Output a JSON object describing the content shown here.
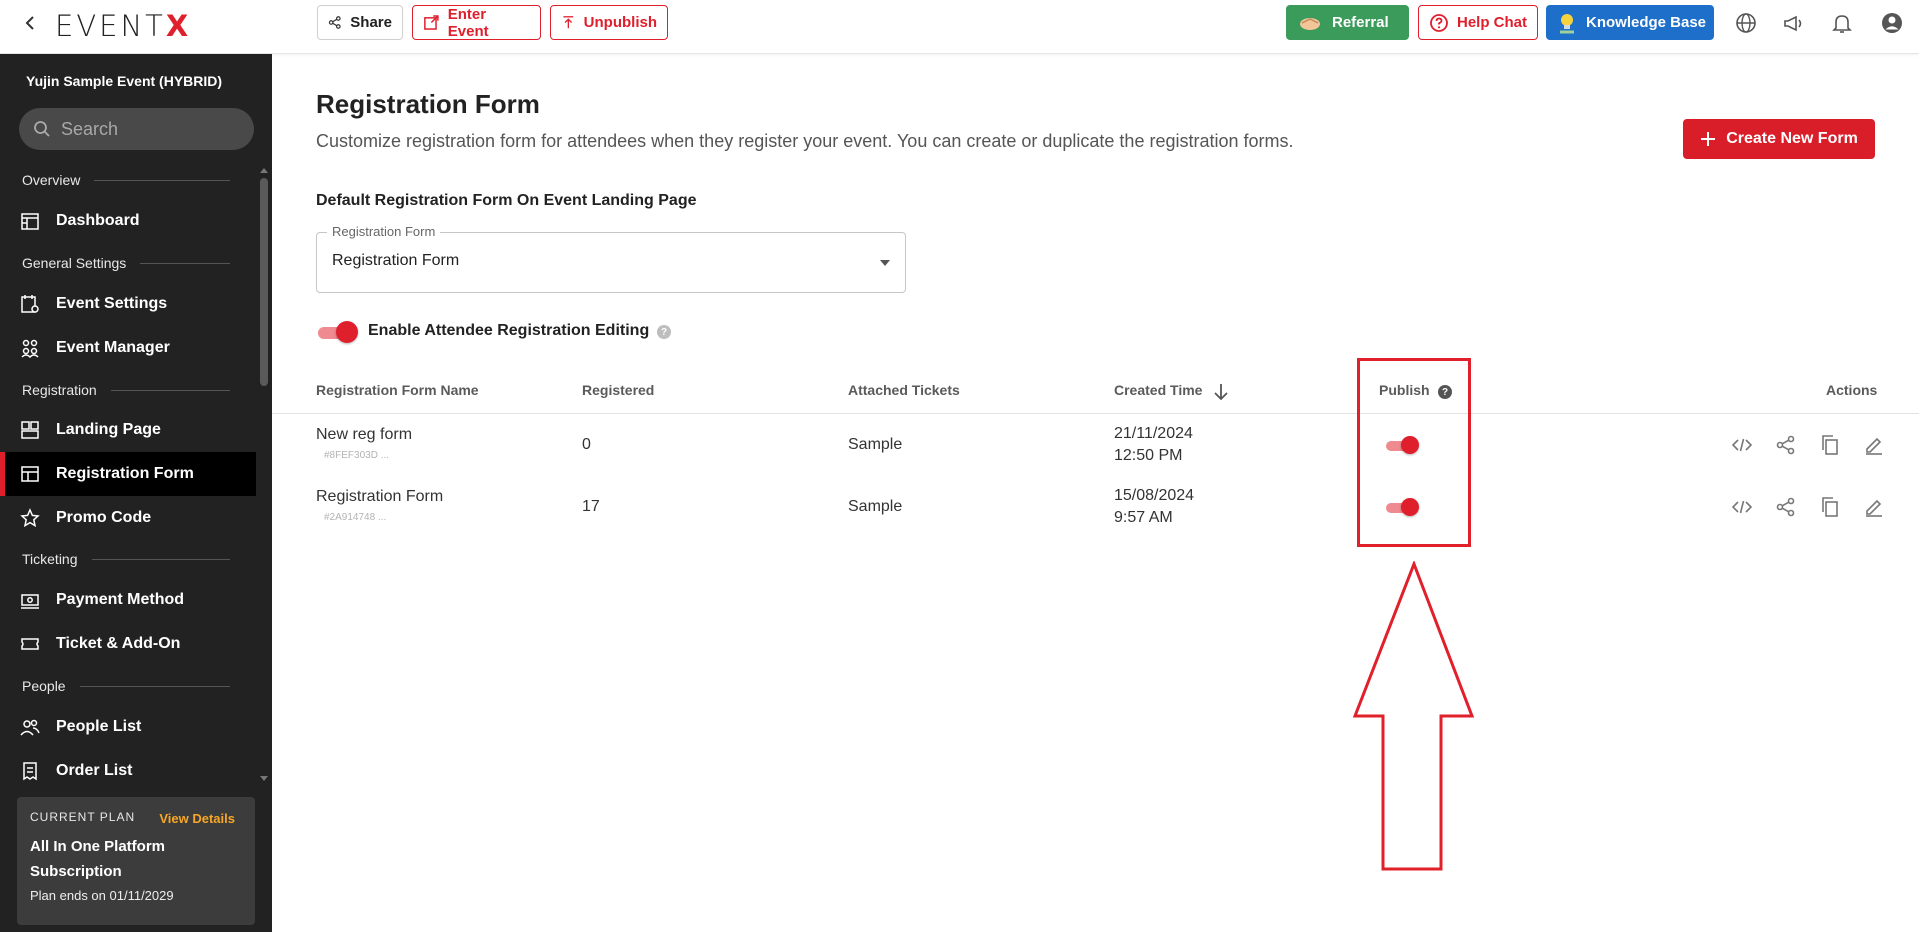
{
  "topbar": {
    "logo": "EVENTX",
    "share": "Share",
    "enter_event": "Enter Event",
    "unpublish": "Unpublish",
    "referral": "Referral",
    "help_chat": "Help Chat",
    "knowledge_base": "Knowledge Base"
  },
  "sidebar": {
    "event_title": "Yujin Sample Event (HYBRID)",
    "search_placeholder": "Search",
    "sections": {
      "overview": "Overview",
      "general": "General Settings",
      "registration": "Registration",
      "ticketing": "Ticketing",
      "people": "People"
    },
    "items": {
      "dashboard": "Dashboard",
      "event_settings": "Event Settings",
      "event_manager": "Event Manager",
      "landing_page": "Landing Page",
      "registration_form": "Registration Form",
      "promo_code": "Promo Code",
      "payment_method": "Payment Method",
      "ticket_addon": "Ticket & Add-On",
      "people_list": "People List",
      "order_list": "Order List"
    },
    "plan": {
      "label": "CURRENT PLAN",
      "view_details": "View Details",
      "name": "All In One Platform Subscription",
      "ends": "Plan ends on 01/11/2029"
    }
  },
  "main": {
    "title": "Registration Form",
    "description": "Customize registration form for attendees when they register your event. You can create or duplicate the registration forms.",
    "create_button": "Create New Form",
    "default_label": "Default Registration Form On Event Landing Page",
    "select_legend": "Registration Form",
    "select_value": "Registration Form",
    "enable_editing_label": "Enable Attendee Registration Editing",
    "enable_editing_on": true,
    "table": {
      "headers": {
        "name": "Registration Form Name",
        "registered": "Registered",
        "tickets": "Attached Tickets",
        "created": "Created Time",
        "publish": "Publish",
        "actions": "Actions"
      },
      "rows": [
        {
          "name": "New reg form",
          "id": "#8FEF303D ...",
          "registered": "0",
          "tickets": "Sample",
          "date": "21/11/2024",
          "time": "12:50 PM",
          "published": true
        },
        {
          "name": "Registration Form",
          "id": "#2A914748 ...",
          "registered": "17",
          "tickets": "Sample",
          "date": "15/08/2024",
          "time": "9:57 AM",
          "published": true
        }
      ]
    }
  },
  "colors": {
    "brand_red": "#e01f2d",
    "sidebar_bg": "#222222",
    "referral_green": "#3b9b5b",
    "kb_blue": "#1d6fc9",
    "plan_link": "#f7a626"
  }
}
